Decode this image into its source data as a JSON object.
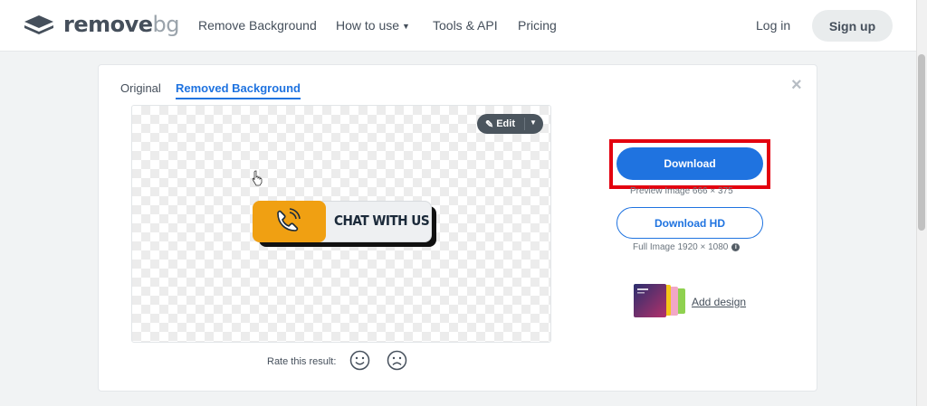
{
  "header": {
    "logo_text": "remove",
    "logo_suffix": "bg",
    "nav": [
      {
        "label": "Remove Background"
      },
      {
        "label": "How to use"
      },
      {
        "label": "Tools & API"
      },
      {
        "label": "Pricing"
      }
    ],
    "login_label": "Log in",
    "signup_label": "Sign up"
  },
  "card": {
    "tabs": [
      {
        "label": "Original",
        "active": false
      },
      {
        "label": "Removed Background",
        "active": true
      }
    ],
    "close_glyph": "×",
    "edit_label": "Edit",
    "edit_icon": "pencil-icon",
    "image_text": "CHAT WITH US",
    "image_icon": "phone-icon",
    "rate_label": "Rate this result:",
    "download_label": "Download",
    "preview_info": "Preview Image 666 × 375",
    "download_hd_label": "Download HD",
    "full_info": "Full Image 1920 × 1080",
    "add_design_label": "Add design"
  },
  "colors": {
    "accent": "#1f73e0",
    "highlight": "#e3000f",
    "orange": "#f0a012",
    "text": "#454f5b"
  }
}
